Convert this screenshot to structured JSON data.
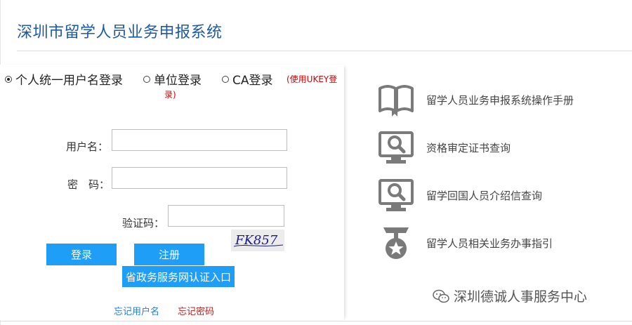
{
  "header": {
    "title": "深圳市留学人员业务申报系统"
  },
  "login": {
    "options": [
      {
        "label": "个人统一用户名登录",
        "checked": true
      },
      {
        "label": "单位登录",
        "checked": false
      },
      {
        "label": "CA登录",
        "checked": false
      }
    ],
    "ukey_note_line1": "(使用UKEY登",
    "ukey_note_line2": "录)",
    "username_label": "用户名：",
    "password_label": "密　码：",
    "captcha_label": "验证码：",
    "captcha_text": "FK857",
    "login_button": "登录",
    "register_button": "注册",
    "gov_button": "省政务服务网认证入口",
    "forgot_username": "忘记用户名",
    "forgot_password": "忘记密码"
  },
  "features": [
    {
      "label": "留学人员业务申报系统操作手册",
      "icon": "book-icon"
    },
    {
      "label": "资格审定证书查询",
      "icon": "search-monitor-icon"
    },
    {
      "label": "留学回国人员介绍信查询",
      "icon": "search-monitor-icon"
    },
    {
      "label": "留学人员相关业务办事指引",
      "icon": "medal-icon"
    }
  ],
  "watermark": {
    "text": "深圳德诚人事服务中心",
    "icon": "wechat-icon"
  },
  "colors": {
    "title_blue": "#1d5aa6",
    "button_blue": "#1e9ef7",
    "note_red": "#d10000",
    "forgot_username_blue": "#2a7bd3",
    "forgot_password_red": "#b22222",
    "icon_gray": "#7a7a7a"
  }
}
